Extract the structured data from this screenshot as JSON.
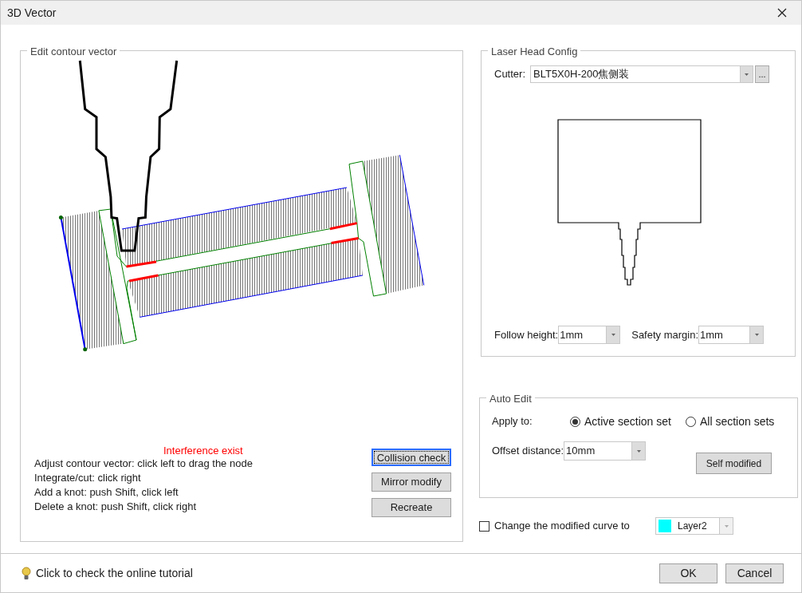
{
  "window": {
    "title": "3D Vector"
  },
  "contour_panel": {
    "title": "Edit contour vector",
    "warning": "Interference exist",
    "instructions": [
      "Adjust contour vector: click left to drag the node",
      "Integrate/cut: click right",
      "Add a knot: push Shift, click left",
      "Delete a knot: push Shift, click right"
    ],
    "buttons": [
      {
        "label": "Collision check",
        "focused": true
      },
      {
        "label": "Mirror modify",
        "focused": false
      },
      {
        "label": "Recreate",
        "focused": false
      }
    ]
  },
  "laser_head": {
    "title": "Laser Head Config",
    "cutter": {
      "label": "Cutter:",
      "value": "BLT5X0H-200焦侧装",
      "more": "..."
    },
    "follow_height": {
      "label": "Follow height:",
      "value": "1mm"
    },
    "safety_margin": {
      "label": "Safety margin:",
      "value": "1mm"
    }
  },
  "auto_edit": {
    "title": "Auto Edit",
    "apply_to": "Apply to:",
    "options": [
      {
        "label": "Active section set",
        "selected": true
      },
      {
        "label": "All section sets",
        "selected": false
      }
    ],
    "offset": {
      "label": "Offset distance:",
      "value": "10mm"
    },
    "button": "Self modified"
  },
  "change_curve": {
    "label": "Change the modified curve to",
    "checked": false,
    "layer": {
      "name": "Layer2",
      "color": "#00ffff"
    }
  },
  "footer": {
    "tutorial": "Click to check the online tutorial",
    "buttons": [
      "OK",
      "Cancel"
    ]
  }
}
